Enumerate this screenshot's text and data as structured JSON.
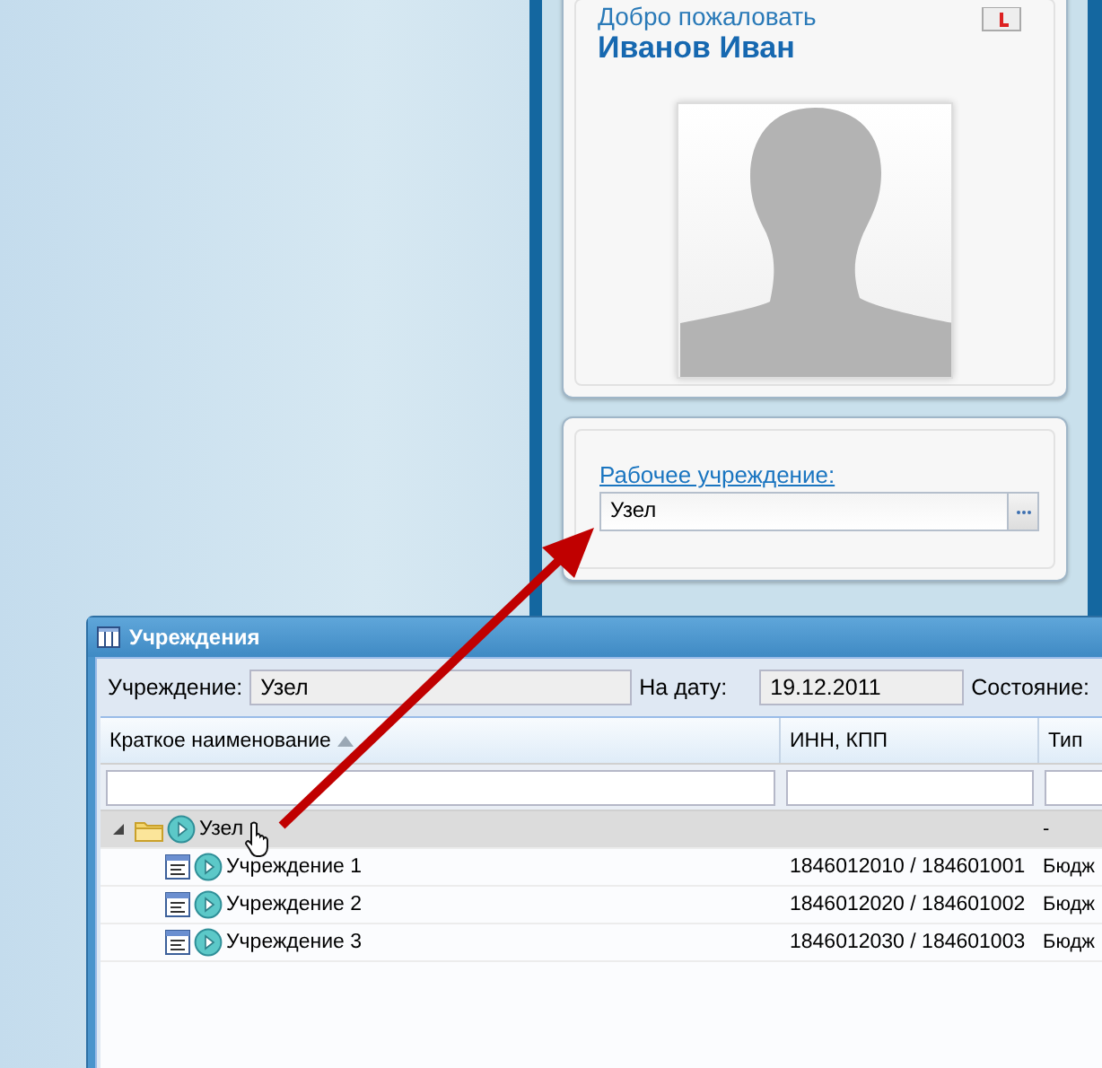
{
  "welcome": {
    "greeting": "Добро пожаловать",
    "user_name": "Иванов Иван"
  },
  "work_institution": {
    "label": "Рабочее учреждение:",
    "value": "Узел"
  },
  "window": {
    "title": "Учреждения",
    "filters": [
      {
        "label": "Учреждение:",
        "value": "Узел"
      },
      {
        "label": "На дату:",
        "value": "19.12.2011"
      },
      {
        "label": "Состояние:"
      }
    ]
  },
  "table": {
    "columns": [
      {
        "label": "Краткое наименование",
        "sort_ascending": true
      },
      {
        "label": "ИНН, КПП"
      },
      {
        "label": "Тип"
      }
    ],
    "rows": [
      {
        "kind": "group",
        "name": "Узел",
        "type": "-",
        "expanded": true,
        "selected": true,
        "children": [
          {
            "kind": "item",
            "name": "Учреждение 1",
            "inn": "1846012010 / 184601001",
            "type": "Бюдж",
            "selected": false
          },
          {
            "kind": "item",
            "name": "Учреждение 2",
            "inn": "1846012020 / 184601002",
            "type": "Бюдж",
            "selected": false
          },
          {
            "kind": "item",
            "name": "Учреждение 3",
            "inn": "1846012030 / 184601003",
            "type": "Бюдж",
            "selected": false
          }
        ]
      }
    ]
  }
}
